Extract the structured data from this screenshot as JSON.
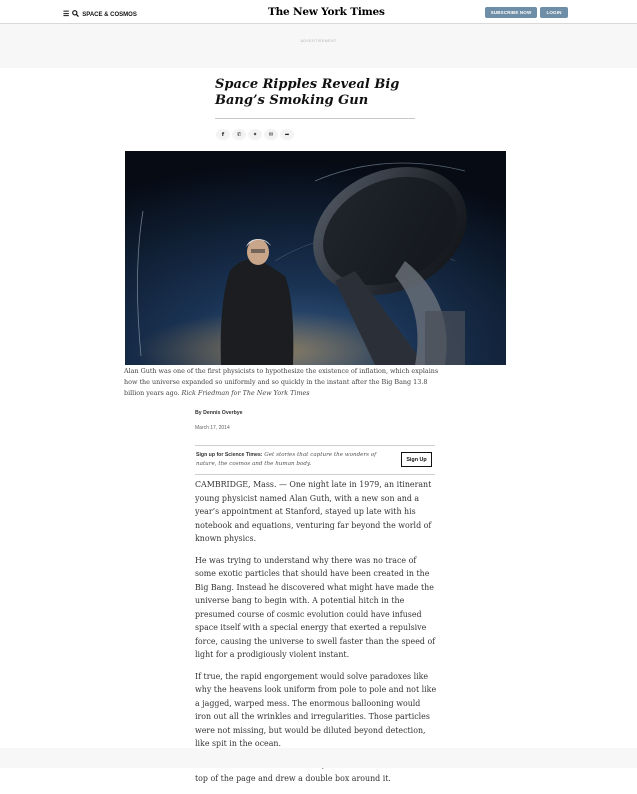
{
  "header": {
    "menu_icon": "hamburger-icon",
    "search_icon": "search-icon",
    "section_label": "SPACE & COSMOS",
    "logo_text": "The New York Times",
    "subscribe_label": "SUBSCRIBE NOW",
    "login_label": "LOGIN",
    "accent_color": "#6e8da6"
  },
  "ad": {
    "label": "ADVERTISEMENT"
  },
  "article": {
    "headline": "Space Ripples Reveal Big Bang’s Smoking Gun",
    "share_icons": [
      "facebook-icon",
      "whatsapp-icon",
      "twitter-icon",
      "email-icon",
      "share-icon"
    ],
    "caption_text": "Alan Guth was one of the first physicists to hypothesize the existence of inflation, which explains how the universe expanded so uniformly and so quickly in the instant after the Big Bang 13.8 billion years ago.",
    "caption_credit": "Rick Friedman for The New York Times",
    "byline": "By Dennis Overbye",
    "date": "March 17, 2014",
    "signup": {
      "title": "Sign up for Science Times:",
      "description": "Get stories that capture the wonders of nature, the cosmos and the human body.",
      "button_label": "Sign Up"
    },
    "paragraphs": [
      "CAMBRIDGE, Mass. — One night late in 1979, an itinerant young physicist named Alan Guth, with a new son and a year’s appointment at Stanford, stayed up late with his notebook and equations, venturing far beyond the world of known physics.",
      "He was trying to understand why there was no trace of some exotic particles that should have been created in the Big Bang. Instead he discovered what might have made the universe bang to begin with. A potential hitch in the presumed course of cosmic evolution could have infused space itself with a special energy that exerted a repulsive force, causing the universe to swell faster than the speed of light for a prodigiously violent instant.",
      "If true, the rapid engorgement would solve paradoxes like why the heavens look uniform from pole to pole and not like a jagged, warped mess. The enormous ballooning would iron out all the wrinkles and irregularities. Those particles were not missing, but would be diluted beyond detection, like spit in the ocean.",
      "“SPECTACULAR REALIZATION,” Dr. Guth wrote across the top of the page and drew a double box around it."
    ]
  }
}
